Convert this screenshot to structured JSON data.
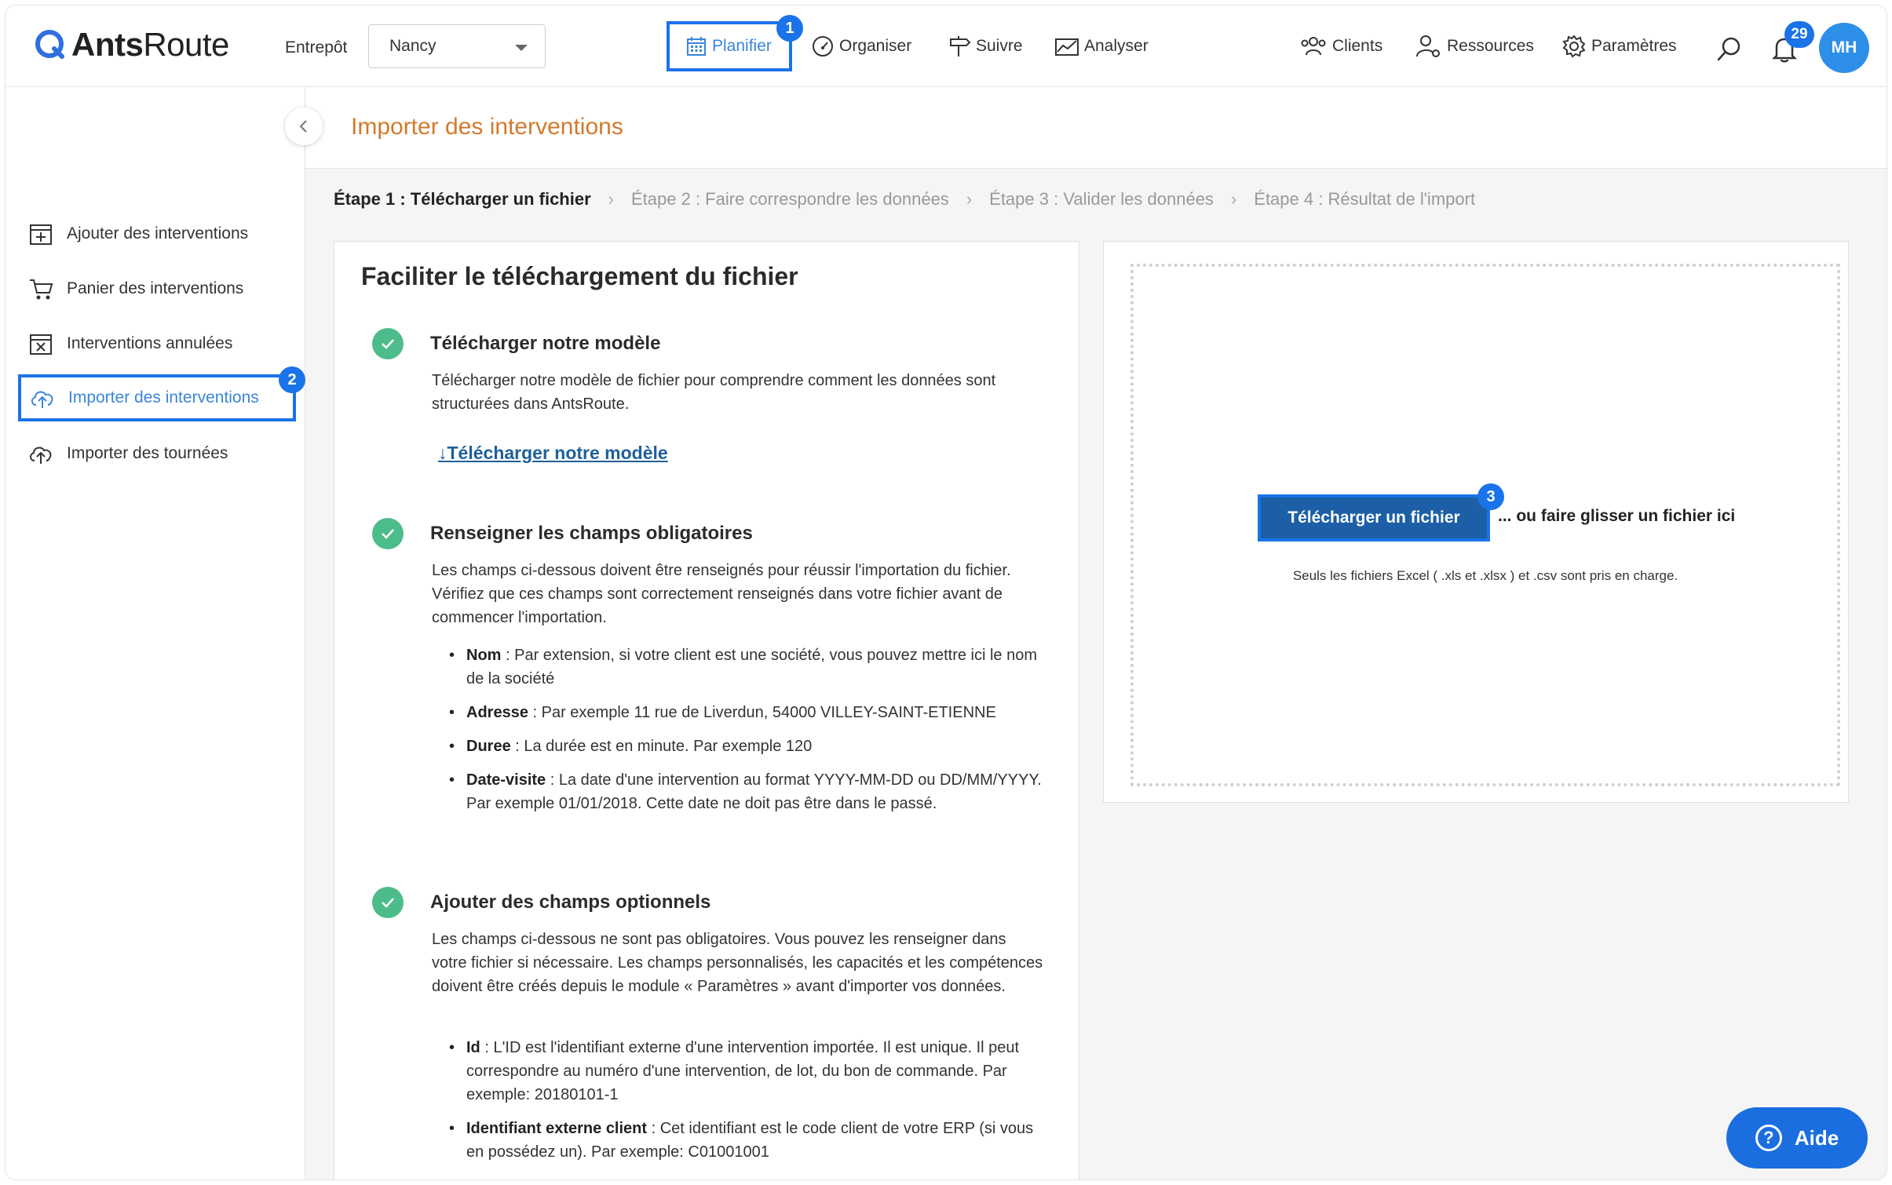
{
  "header": {
    "logo_bold": "Ants",
    "logo_light": "Route",
    "warehouse_label": "Entrepôt",
    "warehouse_value": "Nancy",
    "nav": {
      "planifier": "Planifier",
      "organiser": "Organiser",
      "suivre": "Suivre",
      "analyser": "Analyser",
      "clients": "Clients",
      "ressources": "Ressources",
      "parametres": "Paramètres"
    },
    "notifications_count": "29",
    "avatar_initials": "MH",
    "step_badge_1": "1"
  },
  "sidebar": {
    "items": [
      {
        "label": "Ajouter des interventions"
      },
      {
        "label": "Panier des interventions"
      },
      {
        "label": "Interventions annulées"
      },
      {
        "label": "Importer des interventions"
      },
      {
        "label": "Importer des tournées"
      }
    ],
    "step_badge_2": "2"
  },
  "page": {
    "title": "Importer des interventions",
    "steps": [
      "Étape 1 : Télécharger un fichier",
      "Étape 2 : Faire correspondre les données",
      "Étape 3 : Valider les données",
      "Étape 4 : Résultat de l'import"
    ]
  },
  "left_card": {
    "title": "Faciliter le téléchargement du fichier",
    "s1_title": "Télécharger notre modèle",
    "s1_body": "Télécharger notre modèle de fichier pour comprendre comment les données sont structurées dans AntsRoute.",
    "s1_link": "Télécharger notre modèle",
    "s2_title": "Renseigner les champs obligatoires",
    "s2_body": "Les champs ci-dessous doivent être renseignés pour réussir l'importation du fichier. Vérifiez que ces champs sont correctement renseignés dans votre fichier avant de commencer l'importation.",
    "s2_bullets": [
      {
        "term": "Nom",
        "text": " : Par extension, si votre client est une société, vous pouvez mettre ici le nom de la société"
      },
      {
        "term": "Adresse",
        "text": " : Par exemple 11 rue de Liverdun, 54000 VILLEY-SAINT-ETIENNE"
      },
      {
        "term": "Duree",
        "text": " : La durée est en minute. Par exemple 120"
      },
      {
        "term": "Date-visite",
        "text": " : La date d'une intervention au format YYYY-MM-DD ou DD/MM/YYYY. Par exemple 01/01/2018. Cette date ne doit pas être dans le passé."
      }
    ],
    "s3_title": "Ajouter des champs optionnels",
    "s3_body": "Les champs ci-dessous ne sont pas obligatoires. Vous pouvez les renseigner dans votre fichier si nécessaire. Les champs personnalisés, les capacités et les compétences doivent être créés depuis le module « Paramètres » avant d'importer vos données.",
    "s3_bullets": [
      {
        "term": "Id",
        "text": " : L'ID est l'identifiant externe d'une intervention importée. Il est unique. Il peut correspondre au numéro d'une intervention, de lot, du bon de commande. Par exemple: 20180101-1"
      },
      {
        "term": "Identifiant externe client",
        "text": " : Cet identifiant est le code client de votre ERP (si vous en possédez un). Par exemple: C01001001"
      }
    ]
  },
  "right_card": {
    "upload_label": "Télécharger un fichier",
    "or_drop": "... ou faire glisser un fichier ici",
    "formats": "Seuls les fichiers Excel ( .xls et .xlsx ) et .csv sont pris en charge.",
    "step_badge_3": "3"
  },
  "help": {
    "label": "Aide"
  },
  "colors": {
    "accent": "#1a73e8",
    "title_orange": "#d27a2c",
    "check_green": "#4cbc8a"
  }
}
